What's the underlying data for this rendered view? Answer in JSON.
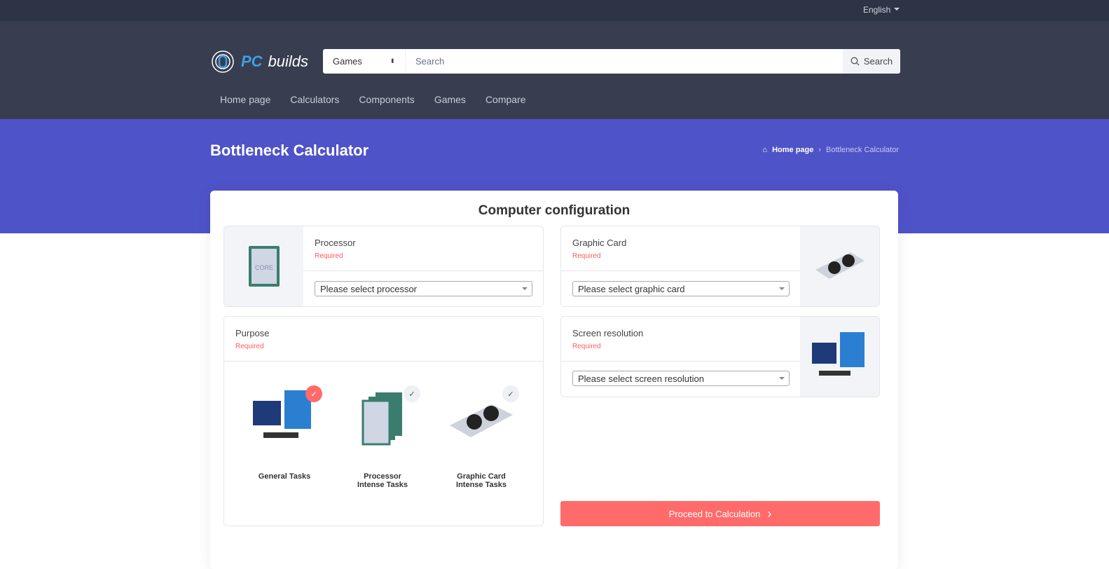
{
  "topbar": {
    "language": "English"
  },
  "header": {
    "logo_pc": "PC",
    "logo_builds": "builds",
    "search_category": "Games",
    "search_placeholder": "Search",
    "search_button": "Search",
    "nav": [
      "Home page",
      "Calculators",
      "Components",
      "Games",
      "Compare"
    ]
  },
  "hero": {
    "title": "Bottleneck Calculator",
    "breadcrumb_home": "Home page",
    "breadcrumb_current": "Bottleneck Calculator"
  },
  "config": {
    "title": "Computer configuration",
    "processor": {
      "label": "Processor",
      "required": "Required",
      "select": "Please select processor"
    },
    "gpu": {
      "label": "Graphic Card",
      "required": "Required",
      "select": "Please select graphic card"
    },
    "resolution": {
      "label": "Screen resolution",
      "required": "Required",
      "select": "Please select screen resolution"
    },
    "purpose": {
      "label": "Purpose",
      "required": "Required",
      "options": [
        {
          "line1": "General Tasks",
          "line2": ""
        },
        {
          "line1": "Processor",
          "line2": "Intense Tasks"
        },
        {
          "line1": "Graphic Card",
          "line2": "Intense Tasks"
        }
      ]
    },
    "proceed": "Proceed to Calculation"
  },
  "colors": {
    "accent": "#ff6b6b",
    "hero": "#4f53c8",
    "header": "#383e50"
  }
}
